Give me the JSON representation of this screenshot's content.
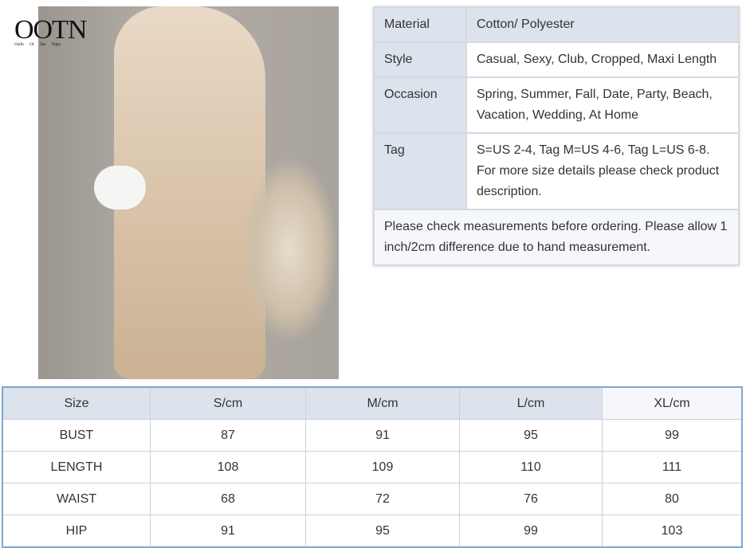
{
  "logo": {
    "title": "OOTN",
    "tagline": "Outfit Of The Night"
  },
  "specs": [
    {
      "key": "Material",
      "value": "Cotton/ Polyester"
    },
    {
      "key": "Style",
      "value": "Casual, Sexy, Club, Cropped, Maxi Length"
    },
    {
      "key": "Occasion",
      "value": "Spring, Summer, Fall, Date, Party, Beach, Vacation, Wedding, At Home"
    },
    {
      "key": "Tag",
      "value": "S=US 2-4, Tag M=US 4-6, Tag L=US 6-8. For more size details please check product description."
    }
  ],
  "note": "Please check measurements before ordering. Please allow 1 inch/2cm difference due to hand measurement.",
  "size_table": {
    "headers": [
      "Size",
      "S/cm",
      "M/cm",
      "L/cm",
      "XL/cm"
    ],
    "rows": [
      [
        "BUST",
        "87",
        "91",
        "95",
        "99"
      ],
      [
        "LENGTH",
        "108",
        "109",
        "110",
        "111"
      ],
      [
        "WAIST",
        "68",
        "72",
        "76",
        "80"
      ],
      [
        "HIP",
        "91",
        "95",
        "99",
        "103"
      ]
    ]
  }
}
